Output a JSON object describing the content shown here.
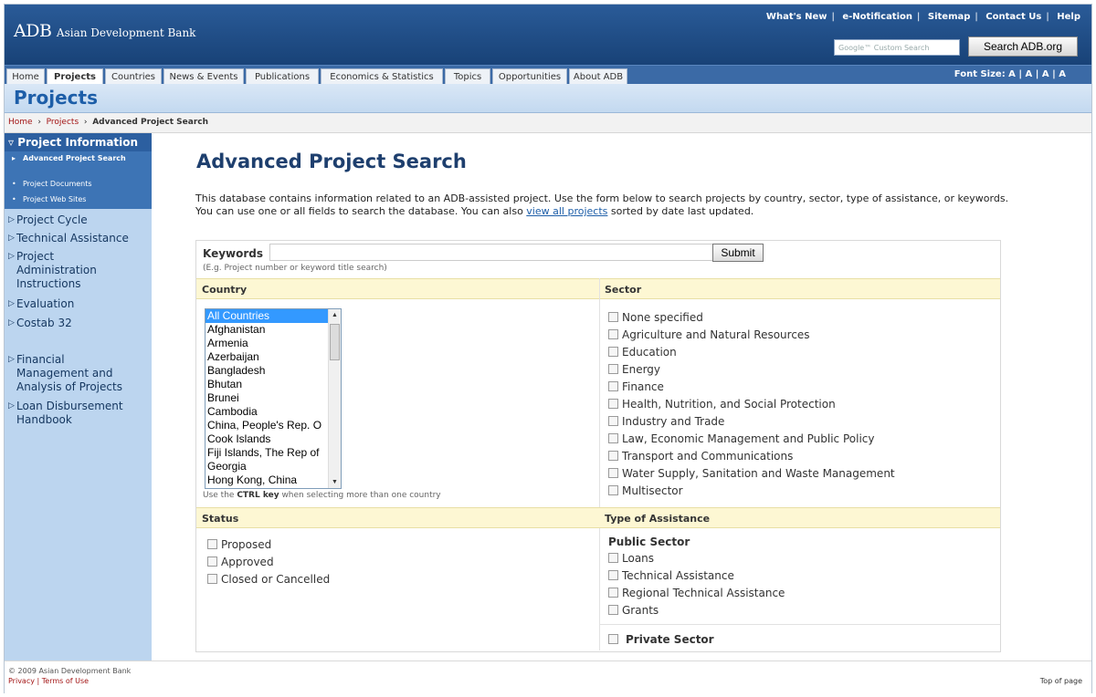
{
  "header": {
    "logo_abbr": "ADB",
    "logo_full": "Asian Development Bank",
    "util_links": [
      "What's New",
      "e-Notification",
      "Sitemap",
      "Contact Us",
      "Help"
    ],
    "search_placeholder": "Google™ Custom Search",
    "search_button": "Search ADB.org"
  },
  "nav": {
    "tabs": [
      "Home",
      "Projects",
      "Countries",
      "News & Events",
      "Publications",
      "Economics & Statistics",
      "Topics",
      "Opportunities",
      "About ADB"
    ],
    "font_size": "Font Size: A | A | A | A"
  },
  "section_title": "Projects",
  "breadcrumb": {
    "home": "Home",
    "projects": "Projects",
    "current": "Advanced Project Search"
  },
  "sidebar": {
    "head": "Project Information",
    "subitems": [
      "Advanced Project Search",
      "Project Documents",
      "Project Web Sites"
    ],
    "items": [
      "Project Cycle",
      "Technical Assistance",
      "Project Administration Instructions",
      "Evaluation",
      "Costab 32",
      "Financial Management and Analysis of Projects",
      "Loan Disbursement Handbook"
    ]
  },
  "main": {
    "title": "Advanced Project Search",
    "intro_text": "This database contains information related to an ADB-assisted project. Use the form below to search projects by country, sector, type of assistance, or keywords. You can use one or all fields to search the database. You can also ",
    "intro_link": "view all projects",
    "intro_tail": " sorted by date last updated."
  },
  "form": {
    "keywords_label": "Keywords",
    "keywords_value": "",
    "keywords_hint": "(E.g. Project number or keyword title search)",
    "submit": "Submit",
    "country_head": "Country",
    "countries": [
      "All Countries",
      "Afghanistan",
      "Armenia",
      "Azerbaijan",
      "Bangladesh",
      "Bhutan",
      "Brunei",
      "Cambodia",
      "China, People's Rep. O",
      "Cook Islands",
      "Fiji Islands, The Rep of",
      "Georgia",
      "Hong Kong, China"
    ],
    "ctrl_hint_pre": "Use the ",
    "ctrl_hint_key": "CTRL key",
    "ctrl_hint_post": " when selecting more than one country",
    "sector_head": "Sector",
    "sectors": [
      "None specified",
      "Agriculture and Natural Resources",
      "Education",
      "Energy",
      "Finance",
      "Health, Nutrition, and Social Protection",
      "Industry and Trade",
      "Law, Economic Management and Public Policy",
      "Transport and Communications",
      "Water Supply, Sanitation and Waste Management",
      "Multisector"
    ],
    "status_head": "Status",
    "statuses": [
      "Proposed",
      "Approved",
      "Closed or Cancelled"
    ],
    "assist_head": "Type of Assistance",
    "public_sector": "Public Sector",
    "assist_types": [
      "Loans",
      "Technical Assistance",
      "Regional Technical Assistance",
      "Grants"
    ],
    "private_sector": "Private Sector"
  },
  "footer": {
    "copyright": "© 2009 Asian Development Bank",
    "legal": "Privacy | Terms of Use",
    "top": "Top of page"
  }
}
